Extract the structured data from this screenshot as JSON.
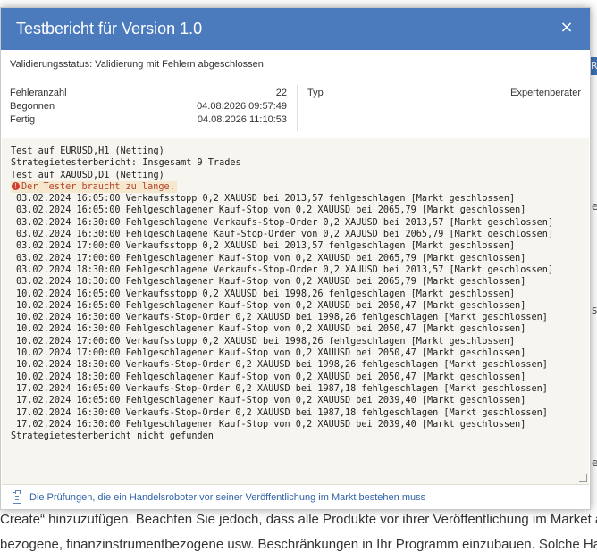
{
  "background": {
    "tab_glyph": "R",
    "line1": "Create“ hinzuzufügen. Beachten Sie jedoch, dass alle Produkte vor ihrer Veröffentlichung im Market auf mögliche",
    "line2": "bezogene, finanzinstrumentbezogene usw. Beschränkungen in Ihr Programm einzubauen. Solche Handlungen",
    "edge_chars": [
      "e",
      "s",
      "e"
    ]
  },
  "modal": {
    "title": "Testbericht für Version 1.0",
    "close_icon": "×",
    "status": "Validierungsstatus: Validierung mit Fehlern abgeschlossen",
    "summary": {
      "error_count_label": "Fehleranzahl",
      "error_count_value": "22",
      "started_label": "Begonnen",
      "started_value": "04.08.2026 09:57:49",
      "finished_label": "Fertig",
      "finished_value": "04.08.2026 11:10:53",
      "type_label": "Typ",
      "type_value": "Expertenberater"
    },
    "log": {
      "header_lines": [
        "Test auf EURUSD,H1 (Netting)",
        "Strategietesterbericht: Insgesamt 9 Trades",
        "Test auf XAUUSD,D1 (Netting)"
      ],
      "warning": "Der Tester braucht zu lange.",
      "entries": [
        "03.02.2024 16:05:00 Verkaufsstopp 0,2 XAUUSD bei 2013,57 fehlgeschlagen [Markt geschlossen]",
        "03.02.2024 16:05:00 Fehlgeschlagener Kauf-Stop von 0,2 XAUUSD bei 2065,79 [Markt geschlossen]",
        "03.02.2024 16:30:00 Fehlgeschlagene Verkaufs-Stop-Order 0,2 XAUUSD bei 2013,57 [Markt geschlossen]",
        "03.02.2024 16:30:00 Fehlgeschlagene Kauf-Stop-Order von 0,2 XAUUSD bei 2065,79 [Markt geschlossen]",
        "03.02.2024 17:00:00 Verkaufsstopp 0,2 XAUUSD bei 2013,57 fehlgeschlagen [Markt geschlossen]",
        "03.02.2024 17:00:00 Fehlgeschlagener Kauf-Stop von 0,2 XAUUSD bei 2065,79 [Markt geschlossen]",
        "03.02.2024 18:30:00 Fehlgeschlagene Verkaufs-Stop-Order 0,2 XAUUSD bei 2013,57 [Markt geschlossen]",
        "03.02.2024 18:30:00 Fehlgeschlagener Kauf-Stop von 0,2 XAUUSD bei 2065,79 [Markt geschlossen]",
        "10.02.2024 16:05:00 Verkaufsstopp 0,2 XAUUSD bei 1998,26 fehlgeschlagen [Markt geschlossen]",
        "10.02.2024 16:05:00 Fehlgeschlagener Kauf-Stop von 0,2 XAUUSD bei 2050,47 [Markt geschlossen]",
        "10.02.2024 16:30:00 Verkaufs-Stop-Order 0,2 XAUUSD bei 1998,26 fehlgeschlagen [Markt geschlossen]",
        "10.02.2024 16:30:00 Fehlgeschlagener Kauf-Stop von 0,2 XAUUSD bei 2050,47 [Markt geschlossen]",
        "10.02.2024 17:00:00 Verkaufsstopp 0,2 XAUUSD bei 1998,26 fehlgeschlagen [Markt geschlossen]",
        "10.02.2024 17:00:00 Fehlgeschlagener Kauf-Stop von 0,2 XAUUSD bei 2050,47 [Markt geschlossen]",
        "10.02.2024 18:30:00 Verkaufs-Stop-Order 0,2 XAUUSD bei 1998,26 fehlgeschlagen [Markt geschlossen]",
        "10.02.2024 18:30:00 Fehlgeschlagener Kauf-Stop von 0,2 XAUUSD bei 2050,47 [Markt geschlossen]",
        "17.02.2024 16:05:00 Verkaufs-Stop-Order 0,2 XAUUSD bei 1987,18 fehlgeschlagen [Markt geschlossen]",
        "17.02.2024 16:05:00 Fehlgeschlagener Kauf-Stop von 0,2 XAUUSD bei 2039,40 [Markt geschlossen]",
        "17.02.2024 16:30:00 Verkaufs-Stop-Order 0,2 XAUUSD bei 1987,18 fehlgeschlagen [Markt geschlossen]",
        "17.02.2024 16:30:00 Fehlgeschlagener Kauf-Stop von 0,2 XAUUSD bei 2039,40 [Markt geschlossen]"
      ],
      "footer_line": "Strategietesterbericht nicht gefunden"
    },
    "footer_link": "Die Prüfungen, die ein Handelsroboter vor seiner Veröffentlichung im Markt bestehen muss",
    "colors": {
      "header": "#4b7bbd",
      "link": "#2f63a8",
      "warning_text": "#b0432a",
      "warning_bg": "#f5e8cf",
      "log_bg": "#f7f5ef"
    },
    "icons": [
      "close-icon",
      "error-icon",
      "document-icon"
    ]
  }
}
